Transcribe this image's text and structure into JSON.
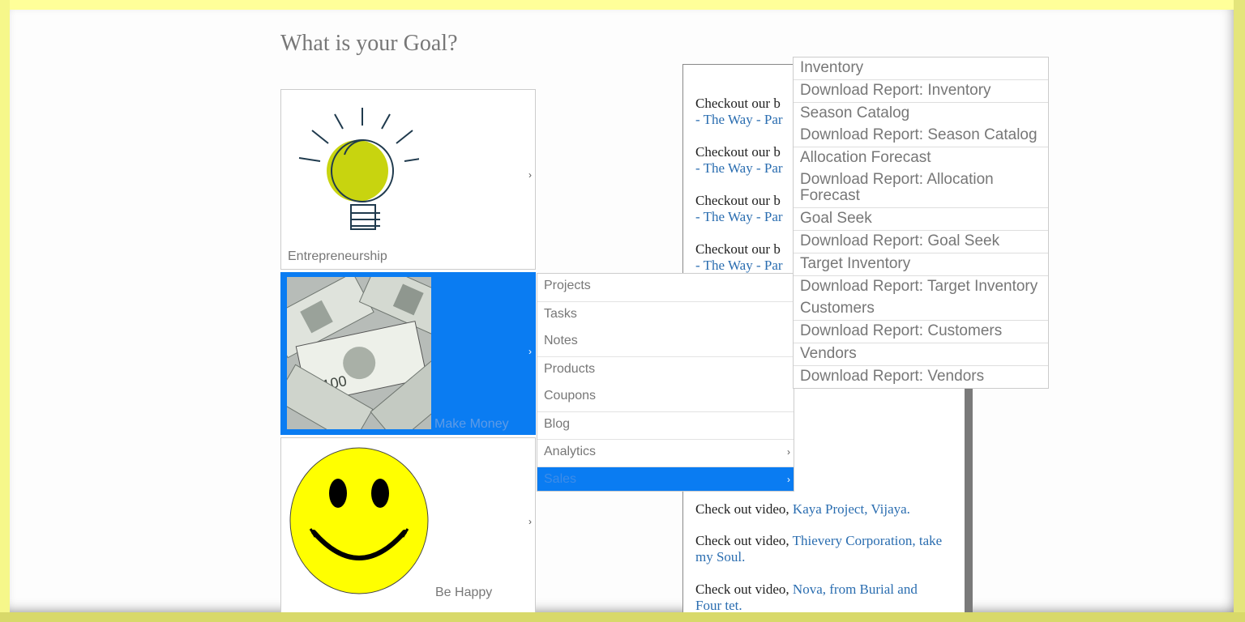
{
  "page": {
    "title": "What is your Goal?"
  },
  "goals": [
    {
      "label": "Entrepreneurship",
      "icon": "lightbulb-icon"
    },
    {
      "label": "Make Money",
      "icon": "money-image"
    },
    {
      "label": "Be Happy",
      "icon": "smiley-icon"
    }
  ],
  "chevron": "›",
  "menu_level1": [
    {
      "label": "Projects"
    },
    {
      "label": "Tasks"
    },
    {
      "label": "Notes"
    },
    {
      "label": "Products"
    },
    {
      "label": "Coupons"
    },
    {
      "label": "Blog"
    },
    {
      "label": "Analytics"
    },
    {
      "label": "Sales"
    }
  ],
  "menu_level2": [
    {
      "label": "Inventory"
    },
    {
      "label": "Download Report: Inventory"
    },
    {
      "label": "Season Catalog"
    },
    {
      "label": "Download Report: Season Catalog"
    },
    {
      "label": "Allocation Forecast"
    },
    {
      "label": "Download Report: Allocation Forecast"
    },
    {
      "label": "Goal Seek"
    },
    {
      "label": "Download Report: Goal Seek"
    },
    {
      "label": "Target Inventory"
    },
    {
      "label": "Download Report: Target Inventory"
    },
    {
      "label": "Customers"
    },
    {
      "label": "Download Report: Customers"
    },
    {
      "label": "Vendors"
    },
    {
      "label": "Download Report: Vendors"
    }
  ],
  "blog": {
    "entries": [
      {
        "text": "Checkout our b",
        "link": "- The Way - Par"
      },
      {
        "text": "Checkout our b",
        "link": "- The Way - Par"
      },
      {
        "text": "Checkout our b",
        "link": "- The Way - Par"
      },
      {
        "text": "Checkout our b",
        "link": "- The Way - Par"
      }
    ],
    "videos": [
      {
        "text": "Check out video, ",
        "link": "Kaya Project, Vijaya."
      },
      {
        "text": "Check out video, ",
        "link": "Thievery Corporation, take my Soul."
      },
      {
        "text": "Check out video, ",
        "link": "Nova, from Burial and Four tet."
      }
    ]
  },
  "colors": {
    "accent": "#0a7cf2",
    "link": "#2a6db0",
    "frame": "#ffff99",
    "bulb": "#c8d40f",
    "smiley": "#ffff00"
  }
}
